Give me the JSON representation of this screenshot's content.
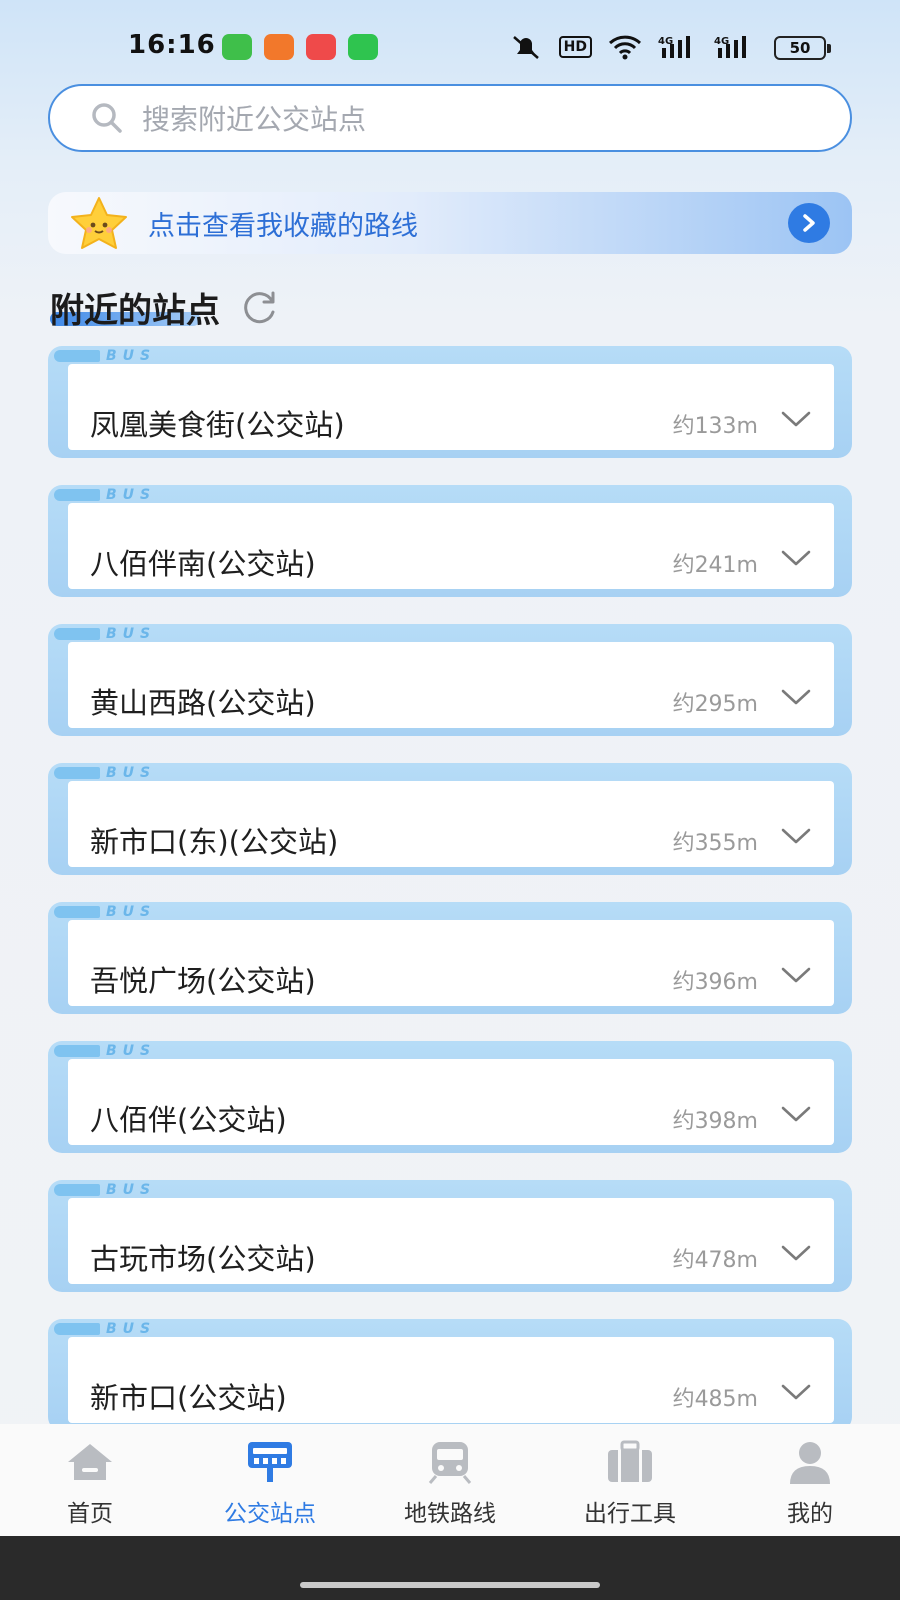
{
  "status_bar": {
    "time": "16:16",
    "battery": "50",
    "network_badge": "HD",
    "signal_1": "4G",
    "signal_2": "4G",
    "app_icons": [
      "#3fbf4a",
      "#f2782b",
      "#ef4a4a",
      "#2fc44f"
    ]
  },
  "search": {
    "placeholder": "搜索附近公交站点",
    "icon": "search-icon"
  },
  "favorites": {
    "label": "点击查看我收藏的路线",
    "icon": "star-icon",
    "arrow_icon": "chevron-right-icon"
  },
  "nearby": {
    "title": "附近的站点",
    "refresh_icon": "refresh-icon",
    "badge_text": "BUS",
    "stations": [
      {
        "name": "凤凰美食街(公交站)",
        "distance": "约133m"
      },
      {
        "name": "八佰伴南(公交站)",
        "distance": "约241m"
      },
      {
        "name": "黄山西路(公交站)",
        "distance": "约295m"
      },
      {
        "name": "新市口(东)(公交站)",
        "distance": "约355m"
      },
      {
        "name": "吾悦广场(公交站)",
        "distance": "约396m"
      },
      {
        "name": "八佰伴(公交站)",
        "distance": "约398m"
      },
      {
        "name": "古玩市场(公交站)",
        "distance": "约478m"
      },
      {
        "name": "新市口(公交站)",
        "distance": "约485m"
      }
    ]
  },
  "bottom_nav": {
    "active_index": 1,
    "accent_color": "#2f7be3",
    "items": [
      {
        "label": "首页",
        "icon": "home-icon"
      },
      {
        "label": "公交站点",
        "icon": "bus-stop-icon"
      },
      {
        "label": "地铁路线",
        "icon": "subway-icon"
      },
      {
        "label": "出行工具",
        "icon": "toolbox-icon"
      },
      {
        "label": "我的",
        "icon": "user-icon"
      }
    ]
  }
}
